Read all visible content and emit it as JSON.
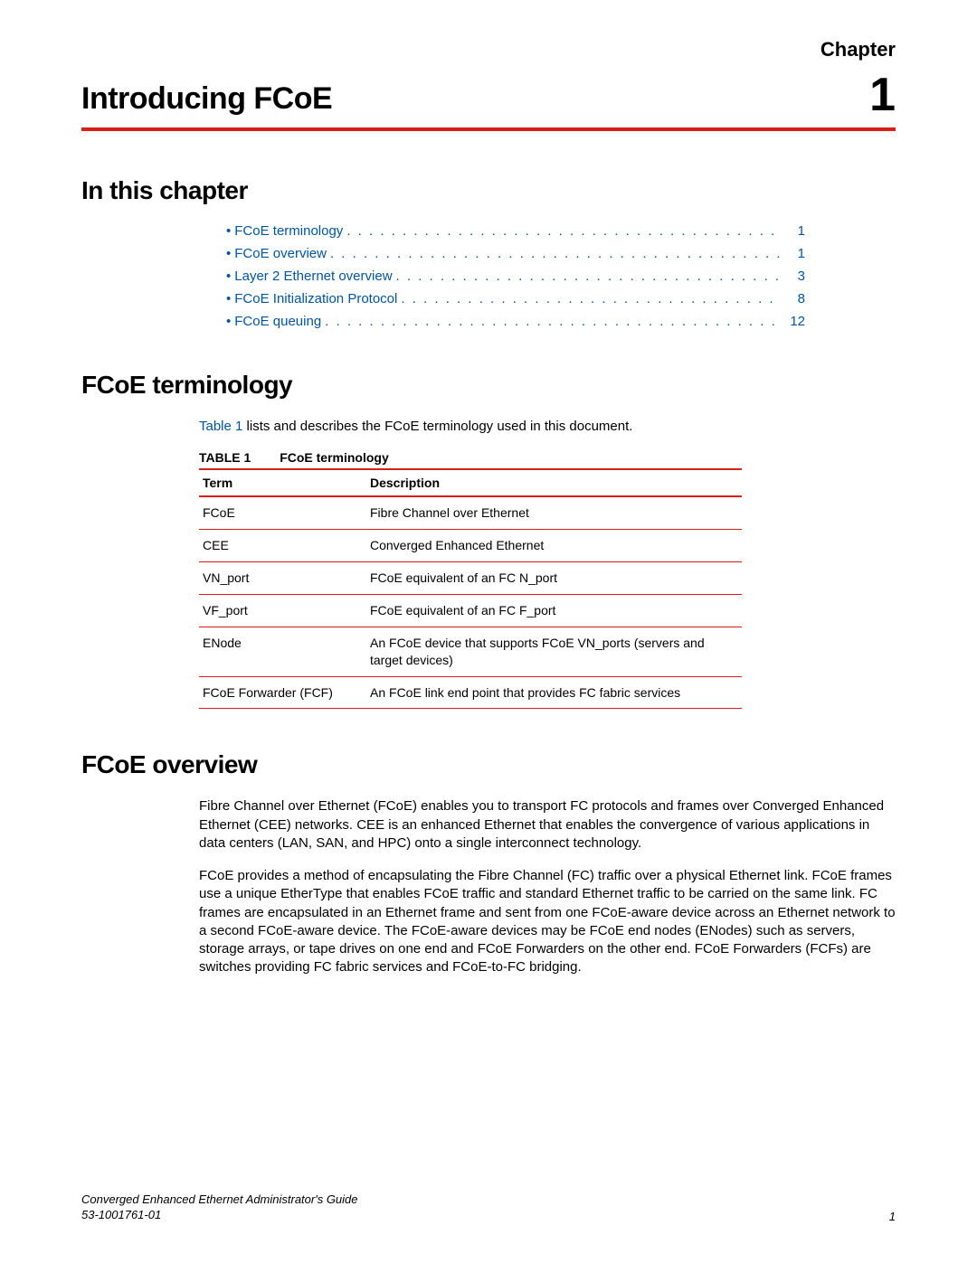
{
  "header": {
    "chapter_label": "Chapter",
    "chapter_title": "Introducing FCoE",
    "chapter_number": "1"
  },
  "sections": {
    "in_this_chapter": "In this chapter",
    "fcoe_terminology": "FCoE terminology",
    "fcoe_overview": "FCoE overview"
  },
  "toc": [
    {
      "label": "FCoE terminology",
      "page": "1"
    },
    {
      "label": "FCoE overview",
      "page": "1"
    },
    {
      "label": "Layer 2 Ethernet overview",
      "page": "3"
    },
    {
      "label": "FCoE Initialization Protocol",
      "page": "8"
    },
    {
      "label": "FCoE queuing",
      "page": "12"
    }
  ],
  "terminology_intro": {
    "link": "Table 1",
    "rest": " lists and describes the FCoE terminology used in this document."
  },
  "table": {
    "caption_label": "TABLE 1",
    "caption_title": "FCoE terminology",
    "col_term": "Term",
    "col_desc": "Description",
    "rows": [
      {
        "term": "FCoE",
        "desc": "Fibre Channel over Ethernet"
      },
      {
        "term": "CEE",
        "desc": "Converged Enhanced Ethernet"
      },
      {
        "term": "VN_port",
        "desc": "FCoE equivalent of an FC N_port"
      },
      {
        "term": "VF_port",
        "desc": "FCoE equivalent of an FC F_port"
      },
      {
        "term": "ENode",
        "desc": "An FCoE device that supports FCoE VN_ports (servers and target devices)"
      },
      {
        "term": "FCoE Forwarder (FCF)",
        "desc": "An FCoE link end point that provides FC fabric services"
      }
    ]
  },
  "overview": {
    "p1": "Fibre Channel over Ethernet (FCoE) enables you to transport FC protocols and frames over Converged Enhanced Ethernet (CEE) networks. CEE is an enhanced Ethernet that enables the convergence of various applications in data centers (LAN, SAN, and HPC) onto a single interconnect technology.",
    "p2": "FCoE provides a method of encapsulating the Fibre Channel (FC) traffic over a physical Ethernet link. FCoE frames use a unique EtherType that enables FCoE traffic and standard Ethernet traffic to be carried on the same link. FC frames are encapsulated in an Ethernet frame and sent from one FCoE-aware device across an Ethernet network to a second FCoE-aware device. The FCoE-aware devices may be FCoE end nodes (ENodes) such as servers, storage arrays, or tape drives on one end and FCoE Forwarders on the other end. FCoE Forwarders (FCFs) are switches providing FC fabric services and FCoE-to-FC bridging."
  },
  "footer": {
    "doc_title": "Converged Enhanced Ethernet Administrator's Guide",
    "doc_id": "53-1001761-01",
    "page": "1"
  }
}
